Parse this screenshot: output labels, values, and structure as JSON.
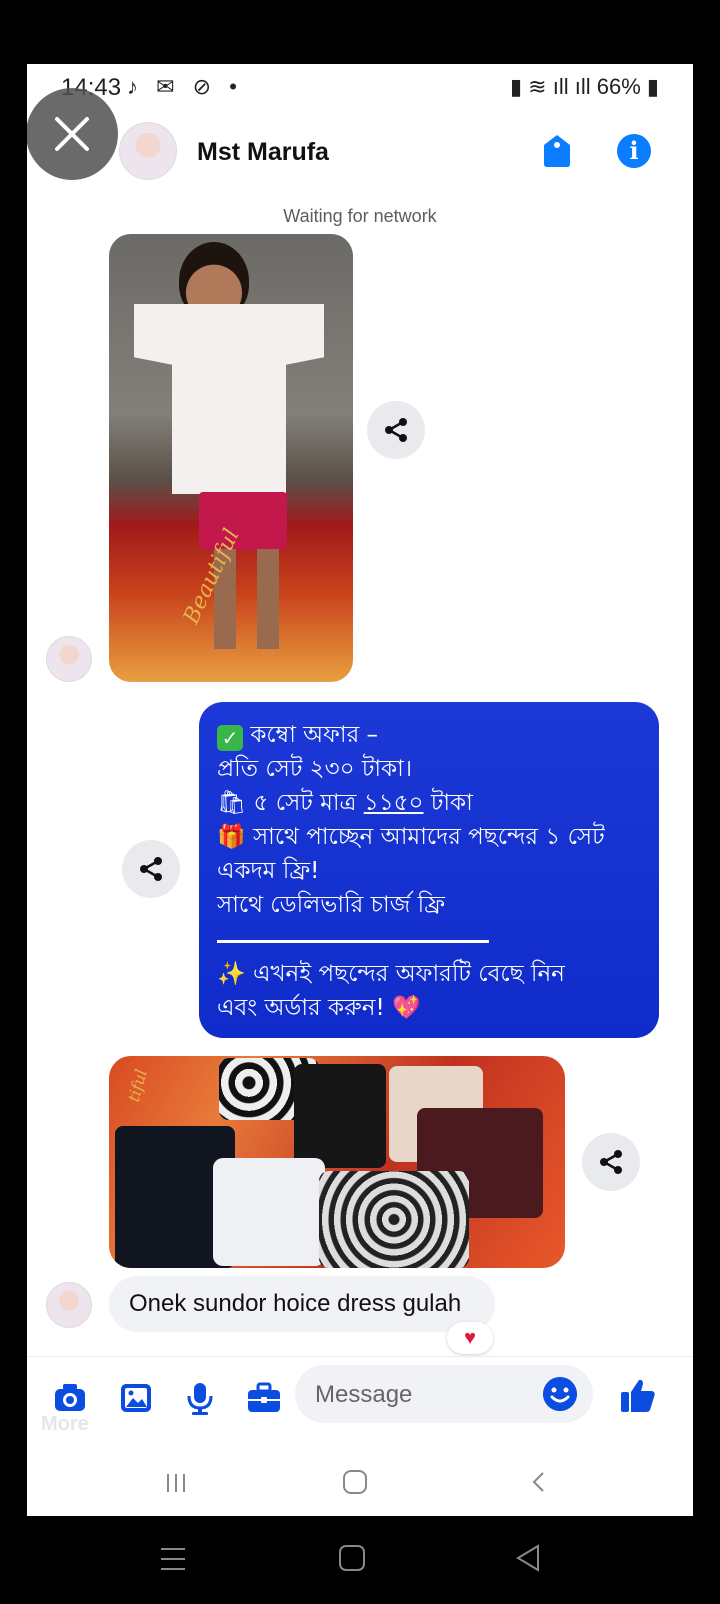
{
  "status_bar": {
    "time": "14:43",
    "battery": "66%"
  },
  "header": {
    "contact_name": "Mst Marufa"
  },
  "chat": {
    "network_status": "Waiting for network",
    "offer_message": {
      "line1": "কম্বো অফার –",
      "line2": "প্রতি সেট ২৩০ টাকা।",
      "line3_prefix": "৫ সেট মাত্র ",
      "line3_price": "১১৫০",
      "line3_suffix": " টাকা",
      "line4": "সাথে পাচ্ছেন আমাদের পছন্দের ১ সেট",
      "line5": "একদম ফ্রি!",
      "line6": "সাথে ডেলিভারি চার্জ ফ্রি",
      "line7": "এখনই পছন্দের অফারটি বেছে নিন",
      "line8": "এবং অর্ডার করুন!"
    },
    "incoming_message": "Onek sundor hoice dress gulah",
    "photo1_watermark": "Beautiful",
    "photo2_watermark": "tiful"
  },
  "composer": {
    "placeholder": "Message",
    "more_label": "More"
  },
  "colors": {
    "accent": "#0a7cff",
    "bubble_out": "#1534d1"
  }
}
